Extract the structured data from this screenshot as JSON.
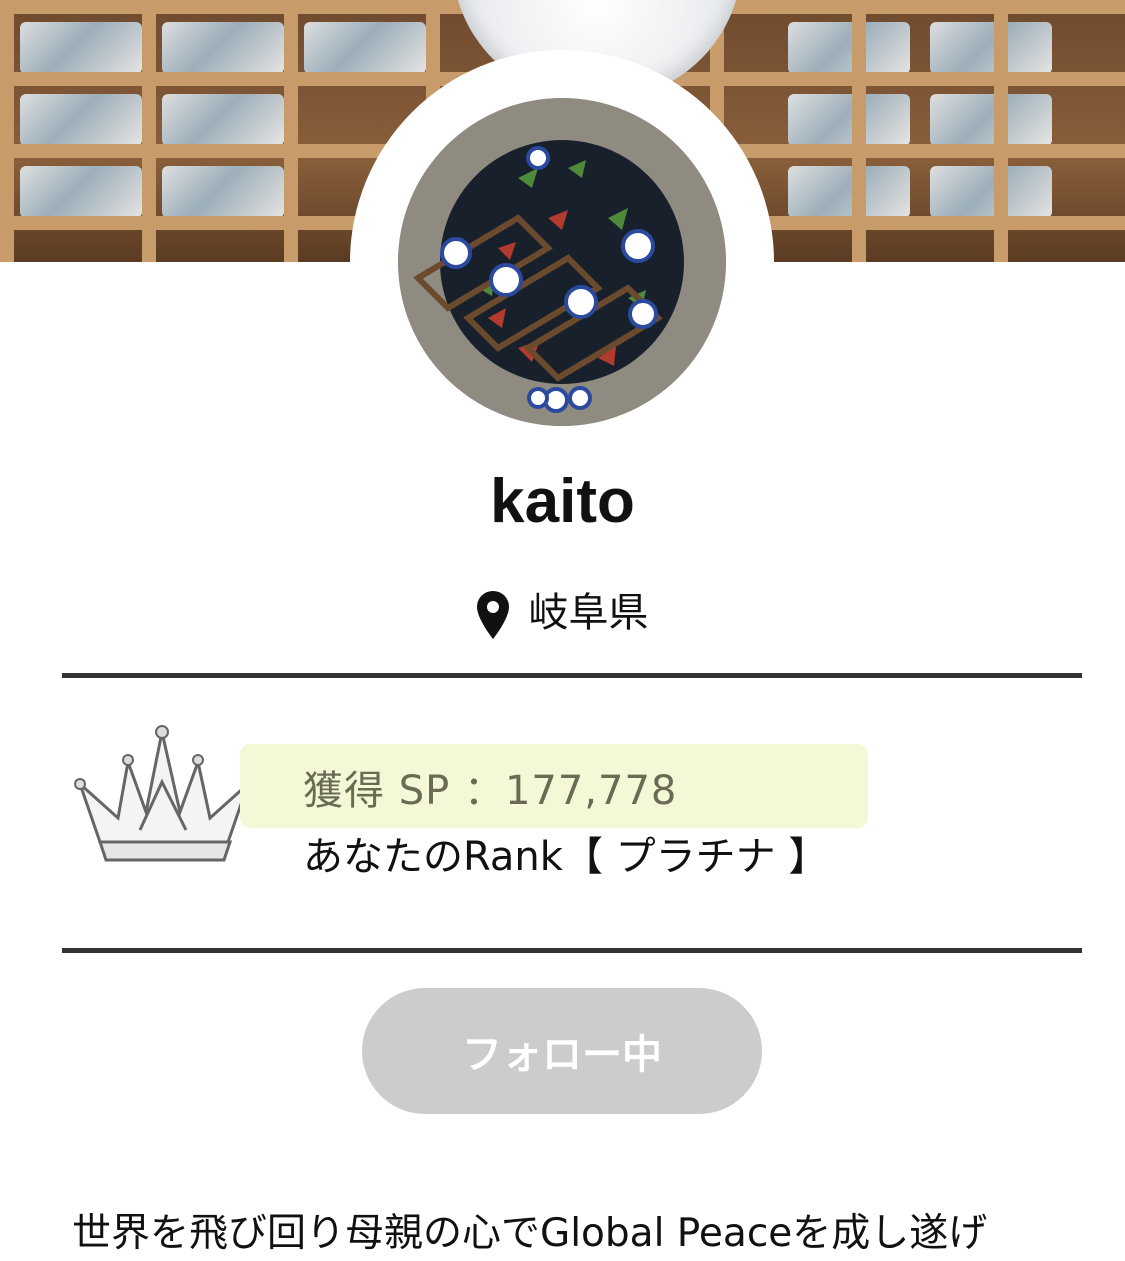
{
  "profile": {
    "username": "kaito",
    "location": "岐阜県"
  },
  "stats": {
    "sp_text": "獲得 SP ：177,778",
    "rank_text": "あなたのRank【 プラチナ 】"
  },
  "actions": {
    "follow_label": "フォロー中"
  },
  "bio": {
    "text": "世界を飛び回り母親の心でGlobal Peaceを成し遂げ"
  },
  "icons": {
    "location": "map-pin-icon",
    "rank": "crown-icon"
  },
  "colors": {
    "follow_button_bg": "#cccccc",
    "sp_highlight": "#f5f8d6",
    "rule": "#333333"
  }
}
